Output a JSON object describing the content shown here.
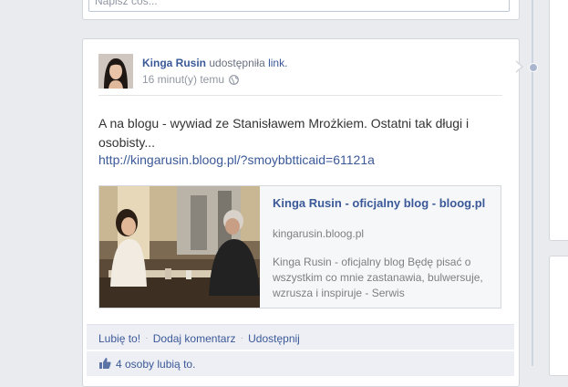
{
  "composer": {
    "placeholder": "Napisz coś..."
  },
  "post": {
    "author": "Kinga Rusin",
    "action_text": "udostępniła",
    "action_link": "link.",
    "time": "16 minut(y) temu",
    "privacy_icon": "globe-icon",
    "text": "A na blogu - wywiad ze Stanisławem Mrożkiem. Ostatni tak długi i osobisty...",
    "url": "http://kingarusin.bloog.pl/?smoybbtticaid=61121a",
    "shared": {
      "title": "Kinga Rusin - oficjalny blog - bloog.pl",
      "domain": "kingarusin.bloog.pl",
      "description": "Kinga Rusin - oficjalny blog Będę pisać o wszystkim co mnie zastanawia, bulwersuje, wzrusza i inspiruje - Serwis"
    },
    "actions": {
      "like": "Lubię to!",
      "comment": "Dodaj komentarz",
      "share": "Udostępnij"
    },
    "likes": {
      "icon": "thumbs-up-icon",
      "count_link": "4 osoby",
      "text": "lubią to."
    }
  },
  "colors": {
    "link": "#3b5998",
    "background": "#e9ebee",
    "timeline": "#ccd3e1"
  }
}
